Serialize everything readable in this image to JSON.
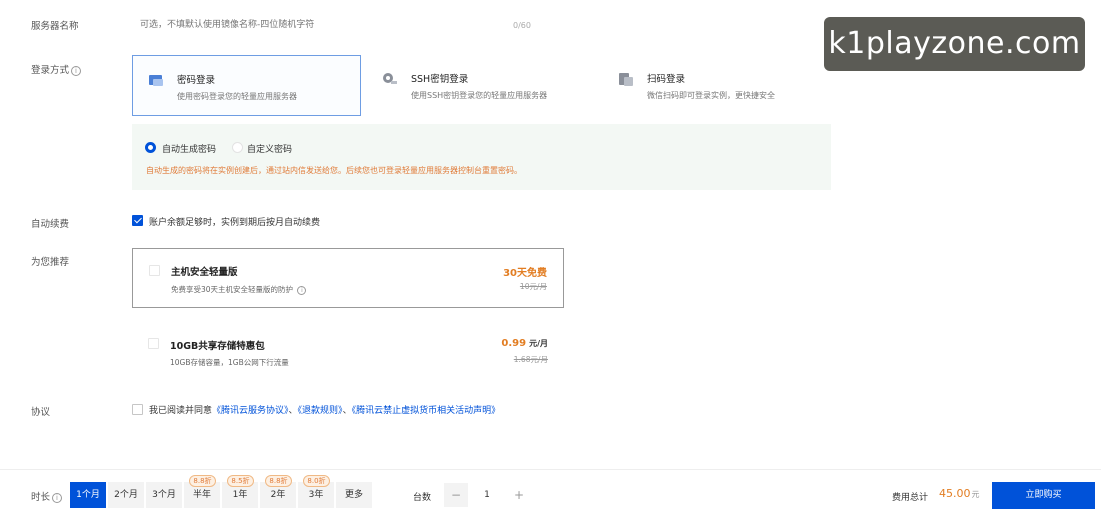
{
  "server_name": {
    "label": "服务器名称",
    "placeholder": "可选，不填默认使用镜像名称-四位随机字符",
    "counter": "0/60"
  },
  "login": {
    "label": "登录方式",
    "options": [
      {
        "title": "密码登录",
        "desc": "使用密码登录您的轻量应用服务器",
        "icon": "password-icon",
        "selected": true
      },
      {
        "title": "SSH密钥登录",
        "desc": "使用SSH密钥登录您的轻量应用服务器",
        "icon": "key-icon",
        "selected": false
      },
      {
        "title": "扫码登录",
        "desc": "微信扫码即可登录实例，更快捷安全",
        "icon": "qr-icon",
        "selected": false
      }
    ],
    "password_modes": [
      {
        "label": "自动生成密码",
        "selected": true
      },
      {
        "label": "自定义密码",
        "selected": false
      }
    ],
    "hint": "自动生成的密码将在实例创建后，通过站内信发送给您。后续您也可登录轻量应用服务器控制台重置密码。"
  },
  "auto_renew": {
    "label": "自动续费",
    "text": "账户余额足够时，实例到期后按月自动续费",
    "checked": true
  },
  "recommend": {
    "label": "为您推荐",
    "items": [
      {
        "title": "主机安全轻量版",
        "desc": "免费享受30天主机安全轻量版的防护",
        "price": "30天免费",
        "unit": "",
        "orig": "10元/月",
        "checked": false
      },
      {
        "title": "10GB共享存储特惠包",
        "desc": "10GB存储容量，1GB公网下行流量",
        "price": "0.99",
        "unit": "元/月",
        "orig": "1.68元/月",
        "checked": false
      }
    ]
  },
  "agreement": {
    "label": "协议",
    "prefix": "我已阅读并同意",
    "link1": "《腾讯云服务协议》",
    "sep1": "、",
    "link2": "《退款规则》",
    "sep2": "、",
    "link3": "《腾讯云禁止虚拟货币相关活动声明》",
    "checked": false
  },
  "bottom": {
    "duration_label": "时长",
    "durations": [
      {
        "label": "1个月",
        "discount": "",
        "selected": true
      },
      {
        "label": "2个月",
        "discount": "",
        "selected": false
      },
      {
        "label": "3个月",
        "discount": "",
        "selected": false
      },
      {
        "label": "半年",
        "discount": "8.8折",
        "selected": false
      },
      {
        "label": "1年",
        "discount": "8.5折",
        "selected": false
      },
      {
        "label": "2年",
        "discount": "8.8折",
        "selected": false
      },
      {
        "label": "3年",
        "discount": "8.0折",
        "selected": false
      },
      {
        "label": "更多",
        "discount": "",
        "selected": false
      }
    ],
    "quantity_label": "台数",
    "minus": "−",
    "quantity": "1",
    "plus": "+",
    "total_label": "费用总计",
    "total_value": "45.00",
    "total_unit": "元",
    "buy_label": "立即购买"
  },
  "watermark": "k1playzone.com",
  "colors": {
    "primary": "#0052d9",
    "price": "#e27d22",
    "hint": "#e07b39",
    "panel": "#f3f8f4"
  }
}
